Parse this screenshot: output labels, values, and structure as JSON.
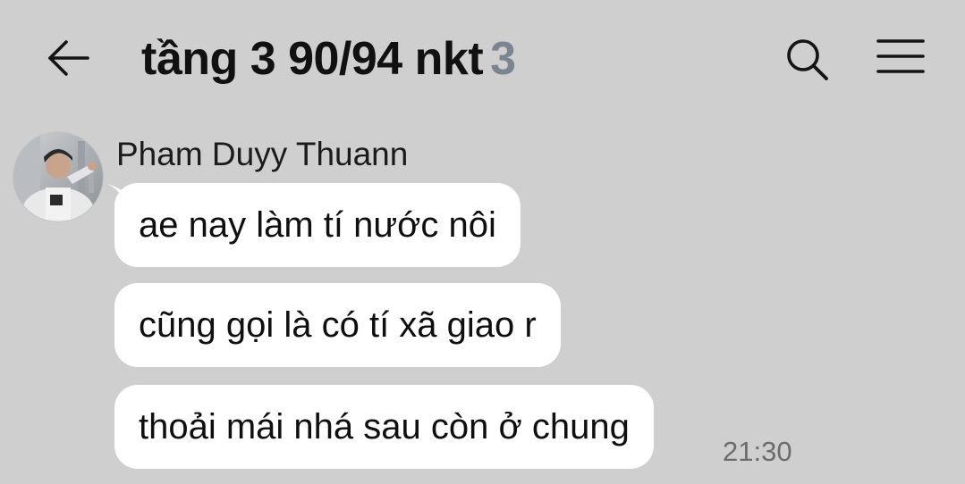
{
  "header": {
    "title": "tầng 3 90/94 nkt",
    "member_count": "3",
    "back_icon": "arrow-left-icon",
    "search_icon": "search-icon",
    "menu_icon": "hamburger-menu-icon"
  },
  "chat": {
    "sender_name": "Pham Duyy Thuann",
    "messages": [
      {
        "text": "ae nay làm tí nước nôi"
      },
      {
        "text": "cũng gọi là có tí xã giao r"
      },
      {
        "text": "thoải mái nhá sau còn ở chung"
      }
    ],
    "last_time": "21:30"
  },
  "colors": {
    "background": "#cfcfcf",
    "bubble": "#ffffff",
    "title_text": "#111111",
    "count_text": "#7b8591",
    "time_text": "#6c6c6c"
  }
}
